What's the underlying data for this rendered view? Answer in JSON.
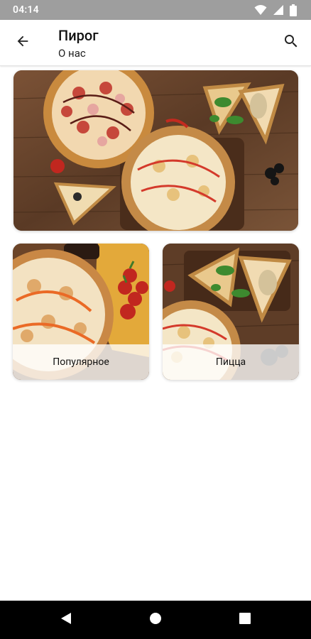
{
  "status_bar": {
    "time": "04:14",
    "icons": [
      "wifi-icon",
      "signal-icon",
      "battery-icon"
    ]
  },
  "app_bar": {
    "title": "Пирог",
    "subtitle": "О нас",
    "back_icon": "arrow-back-icon",
    "search_icon": "search-icon"
  },
  "banner": {
    "image": "pizza-spread-photo"
  },
  "categories": [
    {
      "label": "Популярное",
      "image": "pizza-tomatoes-photo"
    },
    {
      "label": "Пицца",
      "image": "pizza-slices-photo"
    }
  ],
  "nav_bar": {
    "icons": [
      "nav-back-icon",
      "nav-home-icon",
      "nav-recent-icon"
    ]
  },
  "colors": {
    "status_bar": "#9e9e9e",
    "app_bar": "#ffffff",
    "nav_bar": "#000000",
    "card_label_bg": "#ffffffc7"
  }
}
